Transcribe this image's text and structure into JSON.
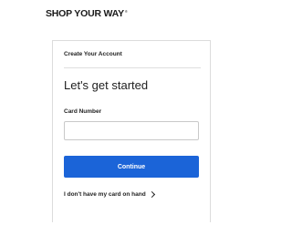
{
  "brand": {
    "name": "SHOP YOUR WAY",
    "trademark": "®"
  },
  "form": {
    "section_label": "Create Your Account",
    "heading": "Let's get started",
    "card_number_label": "Card Number",
    "card_number_value": "",
    "continue_label": "Continue",
    "no_card_link": "I don't have my card on hand"
  },
  "colors": {
    "primary_button": "#1b64d8",
    "border": "#dcdcdc",
    "text": "#222222"
  }
}
